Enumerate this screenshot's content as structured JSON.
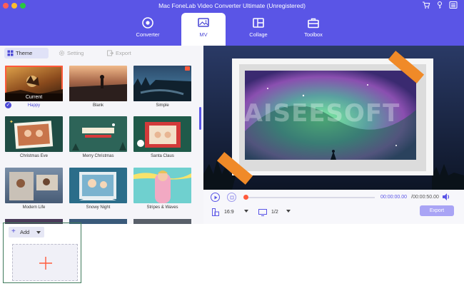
{
  "window": {
    "title": "Mac FoneLab Video Converter Ultimate (Unregistered)",
    "traffic_lights": [
      "#ff5f57",
      "#febc2e",
      "#28c840"
    ],
    "top_icons": [
      "cart-icon",
      "key-icon",
      "menu-icon"
    ]
  },
  "colors": {
    "brand": "#5a55e6",
    "accent": "#ff5a3c",
    "selection": "#4d4ad6"
  },
  "main_tabs": [
    {
      "label": "Converter",
      "icon": "converter-icon",
      "active": false
    },
    {
      "label": "MV",
      "icon": "mv-icon",
      "active": true
    },
    {
      "label": "Collage",
      "icon": "collage-icon",
      "active": false
    },
    {
      "label": "Toolbox",
      "icon": "toolbox-icon",
      "active": false
    }
  ],
  "sub_tabs": [
    {
      "label": "Theme",
      "icon": "grid-icon",
      "active": true
    },
    {
      "label": "Setting",
      "icon": "gear-icon",
      "active": false
    },
    {
      "label": "Export",
      "icon": "export-icon",
      "active": false
    }
  ],
  "themes": [
    {
      "label": "Happy",
      "selected": true,
      "badge": "Current"
    },
    {
      "label": "Blank"
    },
    {
      "label": "Simple"
    },
    {
      "label": "Christmas Eve"
    },
    {
      "label": "Merry Christmas"
    },
    {
      "label": "Santa Claus"
    },
    {
      "label": "Modern Life"
    },
    {
      "label": "Snowy Night"
    },
    {
      "label": "Stripes & Waves"
    }
  ],
  "preview": {
    "watermark": "AISEESOFT"
  },
  "player": {
    "current_time": "00:00:00.00",
    "total_time": "/00:00:50.00",
    "progress": 0.0,
    "aspect_ratio": "16:9",
    "page": "1/2",
    "export_label": "Export"
  },
  "add": {
    "label": "Add"
  }
}
